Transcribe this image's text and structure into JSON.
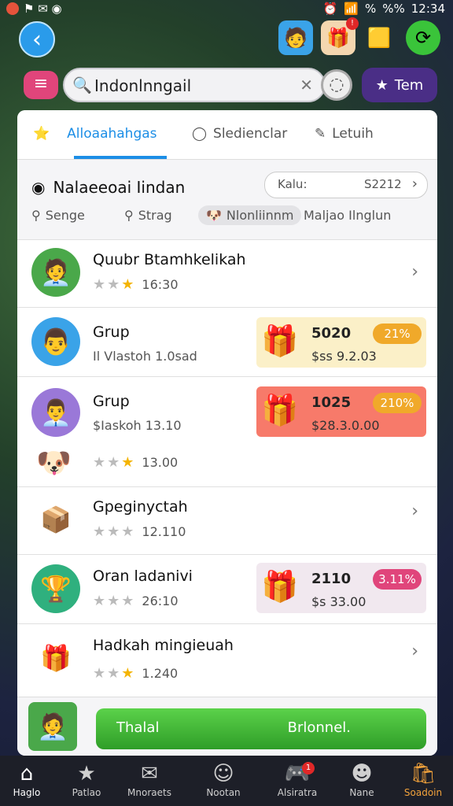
{
  "status": {
    "time": "12:34",
    "battery": "%%",
    "signal": "%"
  },
  "header": {
    "back_icon": "arrow-left-icon",
    "icons": [
      {
        "name": "avatar-profile",
        "badge": ""
      },
      {
        "name": "gift-box",
        "badge": "!"
      },
      {
        "name": "gold-block",
        "badge": ""
      },
      {
        "name": "refresh-green",
        "badge": ""
      }
    ]
  },
  "search": {
    "value": "Indonlnngail",
    "placeholder": "Search",
    "team_label": "Tem"
  },
  "tabs": [
    {
      "label": "Alloaahahgas",
      "active": true
    },
    {
      "label": "Sledienclar",
      "active": false
    },
    {
      "label": "Letuih",
      "active": false
    }
  ],
  "section": {
    "title": "Nalaeeoai Iindan",
    "sort_key": "Kalu:",
    "sort_value": "S2212"
  },
  "filters": [
    "Senge",
    "Strag",
    "Nlonliinnm",
    "Maljao Ilnglun"
  ],
  "rows": [
    {
      "title": "Quubr Btamhkelikah",
      "sub": "",
      "rating": "16:30",
      "stars_on": 1
    },
    {
      "title": "Grup",
      "sub": "Il Vlastoh 1.0sad",
      "rating": "",
      "stars_on": 0,
      "offer": {
        "amount": "5020",
        "pill": "21%",
        "price": "$ss 9.2.03",
        "bg": "#fbf0c8",
        "pill_bg": "#f0a92a"
      }
    },
    {
      "title": "Grup",
      "sub": "$Iaskoh 13.10",
      "rating": "13.00",
      "stars_on": 1,
      "offer": {
        "amount": "1025",
        "pill": "210%",
        "price": "$28.3.0.00",
        "bg": "#f77a6a",
        "pill_bg": "#f0a92a"
      }
    },
    {
      "title": "Gpeginyctah",
      "sub": "",
      "rating": "12.110",
      "stars_on": 0
    },
    {
      "title": "Oran ladanivi",
      "sub": "",
      "rating": "26:10",
      "stars_on": 0,
      "offer": {
        "amount": "2110",
        "pill": "3.11%",
        "price": "$s 33.00",
        "bg": "#f1e8ef",
        "pill_bg": "#e0457b"
      }
    },
    {
      "title": "Hadkah mingieuah",
      "sub": "",
      "rating": "1.240",
      "stars_on": 1
    }
  ],
  "bottom_button": {
    "left": "Thalal",
    "right": "Brlonnel."
  },
  "nav": [
    {
      "label": "Haglo",
      "icon": "home-icon"
    },
    {
      "label": "Patlao",
      "icon": "star-icon"
    },
    {
      "label": "Mnoraets",
      "icon": "mail-icon"
    },
    {
      "label": "Nootan",
      "icon": "chat-icon"
    },
    {
      "label": "Alsiratra",
      "icon": "gamepad-icon",
      "badge": "1"
    },
    {
      "label": "Nane",
      "icon": "person-icon"
    },
    {
      "label": "Soadoin",
      "icon": "shop-icon"
    }
  ]
}
